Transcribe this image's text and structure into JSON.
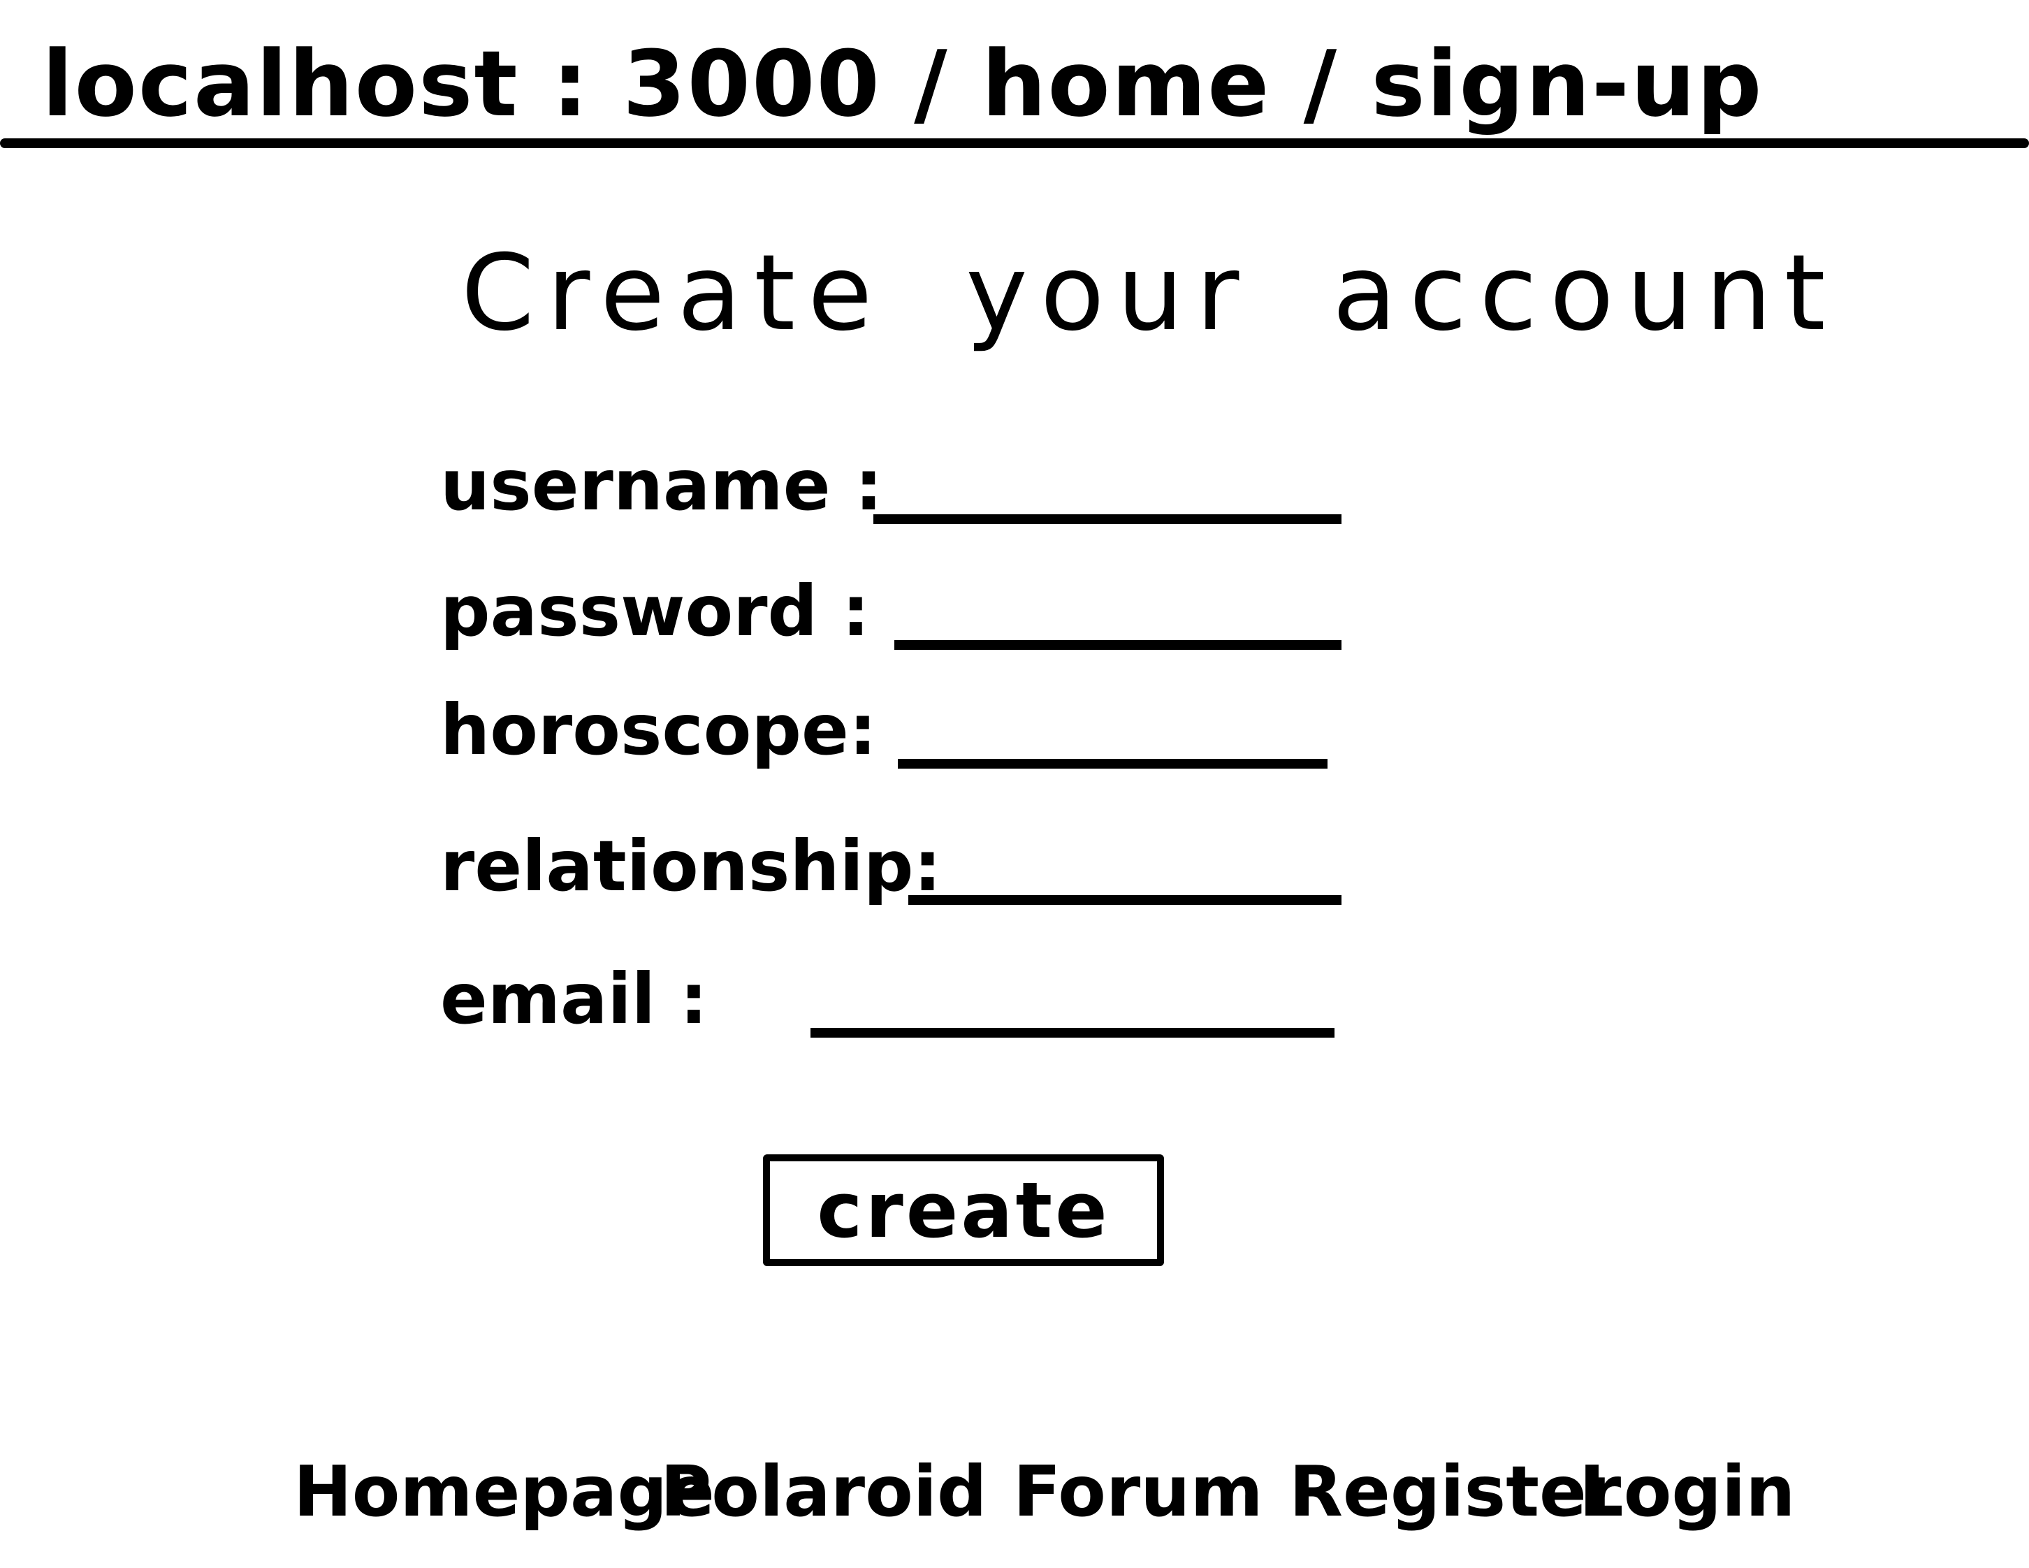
{
  "browser": {
    "url": "localhost : 3000 / home / sign-up"
  },
  "page": {
    "title": "Create your account"
  },
  "form": {
    "fields": [
      {
        "label": "username :",
        "value": ""
      },
      {
        "label": "password :",
        "value": ""
      },
      {
        "label": "horoscope:",
        "value": ""
      },
      {
        "label": "relationship:",
        "value": ""
      },
      {
        "label": "email :",
        "value": ""
      }
    ],
    "submit_label": "create"
  },
  "footer": {
    "nav": [
      {
        "label": "Homepage"
      },
      {
        "label": "Polaroid"
      },
      {
        "label": "Forum"
      },
      {
        "label": "Register"
      },
      {
        "label": "Login"
      }
    ]
  }
}
